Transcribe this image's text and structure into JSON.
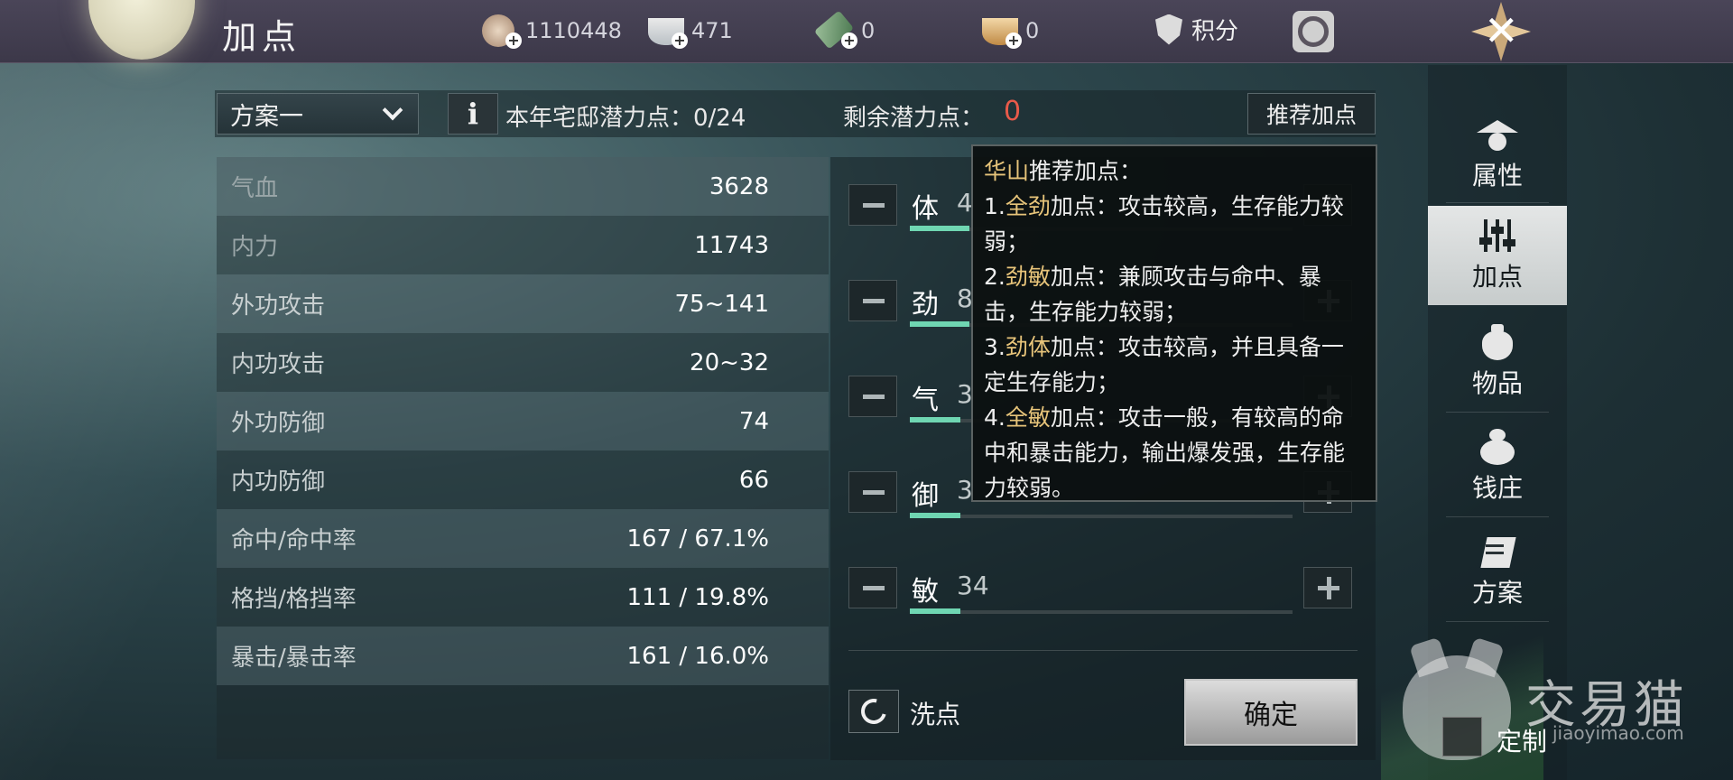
{
  "header": {
    "title": "加点",
    "currencies": [
      {
        "icon": "copper-coin-icon",
        "value": "1110448"
      },
      {
        "icon": "silver-ingot-icon",
        "value": "471"
      },
      {
        "icon": "ticket-icon",
        "value": "0"
      },
      {
        "icon": "gold-ingot-icon",
        "value": "0"
      }
    ],
    "points_label": "积分"
  },
  "options": {
    "plan_select": "方案一",
    "info_glyph": "i",
    "annual_label": "本年宅邸潜力点：0/24",
    "remaining_label": "剩余潜力点：",
    "remaining_value": "0",
    "recommend_button": "推荐加点"
  },
  "stats": [
    {
      "label": "气血",
      "value": "3628"
    },
    {
      "label": "内力",
      "value": "11743"
    },
    {
      "label": "外功攻击",
      "value": "75~141"
    },
    {
      "label": "内功攻击",
      "value": "20~32"
    },
    {
      "label": "外功防御",
      "value": "74"
    },
    {
      "label": "内功防御",
      "value": "66"
    },
    {
      "label": "命中/命中率",
      "value": "167 / 67.1%"
    },
    {
      "label": "格挡/格挡率",
      "value": "111 / 19.8%"
    },
    {
      "label": "暴击/暴击率",
      "value": "161 / 16.0%"
    }
  ],
  "attributes": [
    {
      "name": "体",
      "value": "4"
    },
    {
      "name": "劲",
      "value": "8"
    },
    {
      "name": "气",
      "value": "3"
    },
    {
      "name": "御",
      "value": "3"
    },
    {
      "name": "敏",
      "value": "34"
    }
  ],
  "tooltip": {
    "title_gold": "华山",
    "title_rest": "推荐加点：",
    "items": [
      {
        "prefix": "1.",
        "key": "全劲",
        "text": "加点：攻击较高，生存能力较弱；"
      },
      {
        "prefix": "2.",
        "key": "劲敏",
        "text": "加点：兼顾攻击与命中、暴击，生存能力较弱；"
      },
      {
        "prefix": "3.",
        "key": "劲体",
        "text": "加点：攻击较高，并且具备一定生存能力；"
      },
      {
        "prefix": "4.",
        "key": "全敏",
        "text": "加点：攻击一般，有较高的命中和暴击能力，输出爆发强，生存能力较弱。"
      }
    ]
  },
  "actions": {
    "reset_label": "洗点",
    "confirm_label": "确定"
  },
  "nav": [
    {
      "icon": "hat-icon",
      "label": "属性",
      "active": false
    },
    {
      "icon": "sliders-icon",
      "label": "加点",
      "active": true
    },
    {
      "icon": "bag-icon",
      "label": "物品",
      "active": false
    },
    {
      "icon": "money-bag-icon",
      "label": "钱庄",
      "active": false
    },
    {
      "icon": "scroll-icon",
      "label": "方案",
      "active": false
    }
  ],
  "watermark": {
    "text": "交易猫",
    "url": "jiaoyimao.com",
    "custom_label": "定制"
  },
  "colors": {
    "accent_green": "#6fd6b2",
    "warning_red": "#e85a4a",
    "tooltip_gold": "#e7c47a"
  }
}
